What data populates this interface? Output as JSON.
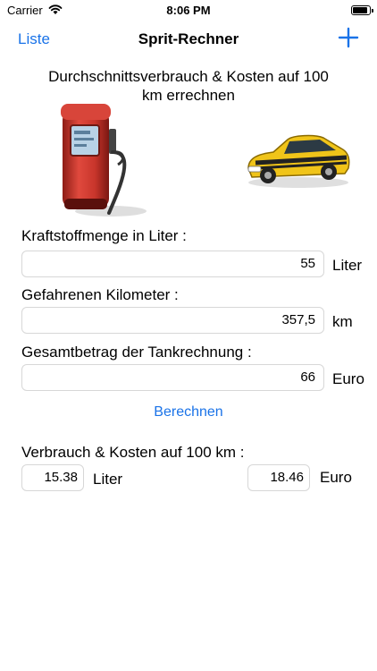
{
  "status_bar": {
    "carrier": "Carrier",
    "time": "8:06 PM"
  },
  "nav": {
    "left": "Liste",
    "title": "Sprit-Rechner"
  },
  "heading": {
    "line1": "Durchschnittsverbrauch & Kosten auf 100",
    "line2": "km errechnen"
  },
  "fuel": {
    "label": "Kraftstoffmenge in Liter :",
    "value": "55",
    "unit": "Liter"
  },
  "distance": {
    "label": "Gefahrenen Kilometer :",
    "value": "357,5",
    "unit": "km"
  },
  "total": {
    "label": "Gesamtbetrag der Tankrechnung :",
    "value": "66",
    "unit": "Euro"
  },
  "calculate_button": "Berechnen",
  "result": {
    "label": "Verbrauch & Kosten auf 100 km :",
    "consumption": {
      "value": "15.38",
      "unit": "Liter"
    },
    "cost": {
      "value": "18.46",
      "unit": "Euro"
    }
  },
  "colors": {
    "accent": "#1a73e8",
    "pump": "#c8352b",
    "car": "#f0c419"
  }
}
